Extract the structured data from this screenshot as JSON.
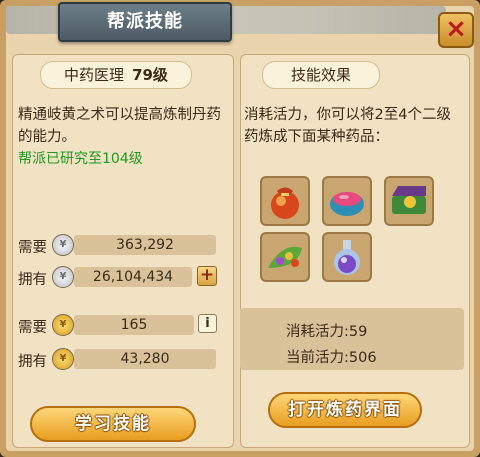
{
  "window": {
    "title": "帮派技能",
    "close_icon": "×"
  },
  "skill": {
    "name": "中药医理",
    "level": "79级",
    "description": "精通岐黄之术可以提高炼制丹药的能力。",
    "researched": "帮派已研究至104级"
  },
  "costs": [
    {
      "label": "需要",
      "icon": "silver-coin-icon",
      "value": "363,292"
    },
    {
      "label": "拥有",
      "icon": "silver-coin-icon",
      "value": "26,104,434"
    },
    {
      "label": "需要",
      "icon": "gold-coin-icon",
      "value": "165"
    },
    {
      "label": "拥有",
      "icon": "gold-coin-icon",
      "value": "43,280"
    }
  ],
  "buttons": {
    "plus": "+",
    "info": "i",
    "learn": "学习技能",
    "refine": "打开炼药界面"
  },
  "effect": {
    "header": "技能效果",
    "description": "消耗活力，你可以将2至4个二级药炼成下面某种药品："
  },
  "medicines": [
    {
      "icon": "pouch-elixir-icon"
    },
    {
      "icon": "pink-bowl-icon"
    },
    {
      "icon": "green-box-pill-icon"
    },
    {
      "icon": "herb-leaf-icon"
    },
    {
      "icon": "potion-bottle-icon"
    }
  ],
  "vitality": {
    "consume": "消耗活力:59",
    "current": "当前活力:506"
  }
}
